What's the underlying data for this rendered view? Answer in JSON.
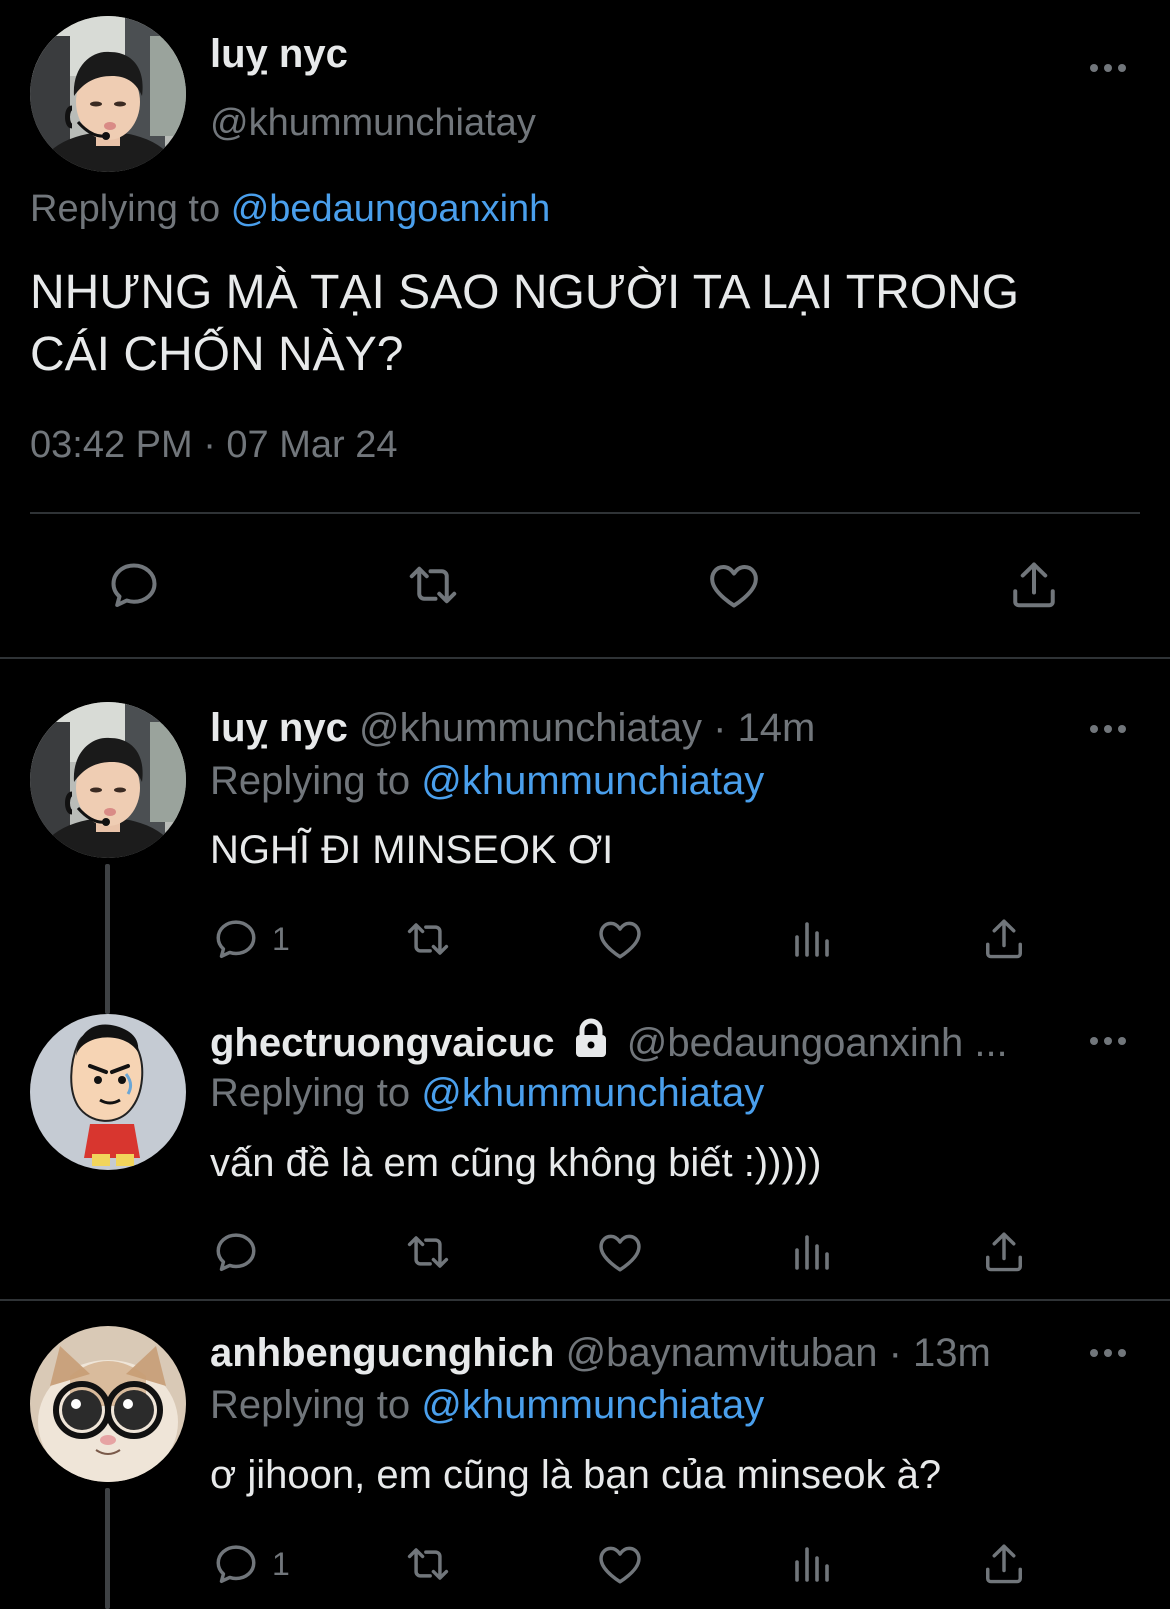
{
  "main_tweet": {
    "display_name": "luỵ nyc",
    "handle": "@khummunchiatay",
    "replying_prefix": "Replying to",
    "replying_to": "@bedaungoanxinh",
    "text_line1": "NHƯNG MÀ TẠI SAO NGƯỜI TA LẠI TRONG",
    "text_line2": "CÁI CHỐN NÀY?",
    "timestamp": "03:42 PM · 07 Mar 24"
  },
  "replies": [
    {
      "display_name": "luỵ nyc",
      "handle": "@khummunchiatay",
      "time": "· 14m",
      "replying_prefix": "Replying to",
      "replying_to": "@khummunchiatay",
      "text": "NGHĨ ĐI MINSEOK ƠI",
      "reply_count": "1"
    },
    {
      "display_name": "ghectruongvaicuc",
      "handle": "@bedaungoanxinh ...",
      "replying_prefix": "Replying to",
      "replying_to": "@khummunchiatay",
      "text": "vấn đề là em cũng không biết :)))))",
      "reply_count": ""
    },
    {
      "display_name": "anhbengucnghich",
      "handle": "@baynamvituban",
      "time": "· 13m",
      "replying_prefix": "Replying to",
      "replying_to": "@khummunchiatay",
      "text": "ơ jihoon, em cũng là bạn của minseok à?",
      "reply_count": "1"
    }
  ],
  "icons": {
    "reply": "speech-bubble-icon",
    "retweet": "retweet-icon",
    "like": "heart-icon",
    "analytics": "bar-chart-icon",
    "share": "share-upload-icon",
    "more": "ellipsis-icon",
    "lock": "lock-icon"
  },
  "colors": {
    "background": "#000000",
    "text": "#e7e9ea",
    "secondary": "#71767b",
    "link": "#4a9fec",
    "divider": "#2f3336"
  }
}
